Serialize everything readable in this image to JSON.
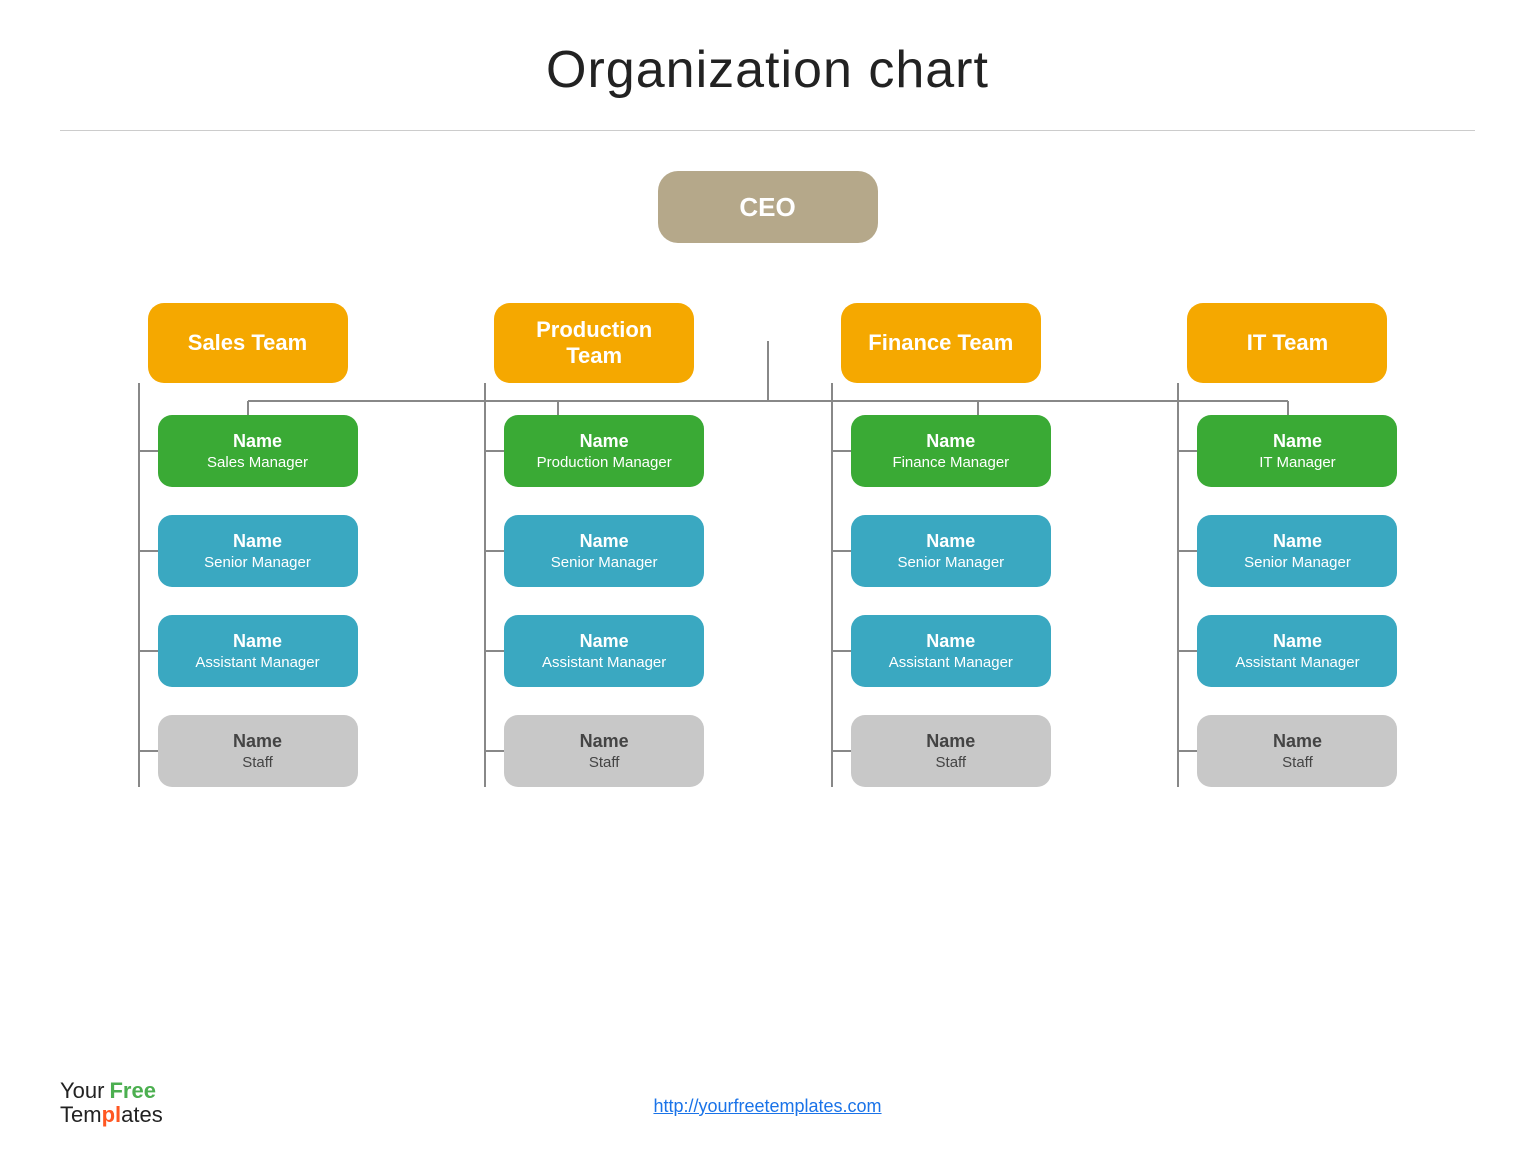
{
  "page": {
    "title": "Organization chart",
    "footer_url": "http://yourfreetemplates.com",
    "footer_logo_your": "Your",
    "footer_logo_free": "Free",
    "footer_logo_templates_plain": "Tem",
    "footer_logo_templates_accent": "pl",
    "footer_logo_templates_end": "ates"
  },
  "ceo": {
    "label": "CEO"
  },
  "teams": [
    {
      "id": "sales",
      "label": "Sales Team"
    },
    {
      "id": "production",
      "label": "Production\nTeam"
    },
    {
      "id": "finance",
      "label": "Finance Team"
    },
    {
      "id": "it",
      "label": "IT Team"
    }
  ],
  "managers": [
    {
      "id": "sales-mgr",
      "name": "Name",
      "role": "Sales Manager"
    },
    {
      "id": "prod-mgr",
      "name": "Name",
      "role": "Production Manager"
    },
    {
      "id": "fin-mgr",
      "name": "Name",
      "role": "Finance Manager"
    },
    {
      "id": "it-mgr",
      "name": "Name",
      "role": "IT Manager"
    }
  ],
  "seniors": [
    {
      "id": "sales-sr",
      "name": "Name",
      "role": "Senior Manager"
    },
    {
      "id": "prod-sr",
      "name": "Name",
      "role": "Senior Manager"
    },
    {
      "id": "fin-sr",
      "name": "Name",
      "role": "Senior Manager"
    },
    {
      "id": "it-sr",
      "name": "Name",
      "role": "Senior Manager"
    }
  ],
  "assistants": [
    {
      "id": "sales-asst",
      "name": "Name",
      "role": "Assistant Manager"
    },
    {
      "id": "prod-asst",
      "name": "Name",
      "role": "Assistant Manager"
    },
    {
      "id": "fin-asst",
      "name": "Name",
      "role": "Assistant Manager"
    },
    {
      "id": "it-asst",
      "name": "Name",
      "role": "Assistant Manager"
    }
  ],
  "staffs": [
    {
      "id": "sales-staff",
      "name": "Name",
      "role": "Staff"
    },
    {
      "id": "prod-staff",
      "name": "Name",
      "role": "Staff"
    },
    {
      "id": "fin-staff",
      "name": "Name",
      "role": "Staff"
    },
    {
      "id": "it-staff",
      "name": "Name",
      "role": "Staff"
    }
  ],
  "colors": {
    "ceo_bg": "#b5a88a",
    "team_bg": "#f5a800",
    "manager_bg": "#3aaa35",
    "senior_bg": "#3aa8c1",
    "assistant_bg": "#3aa8c1",
    "staff_bg": "#c5c5c5",
    "connector": "#888888"
  }
}
